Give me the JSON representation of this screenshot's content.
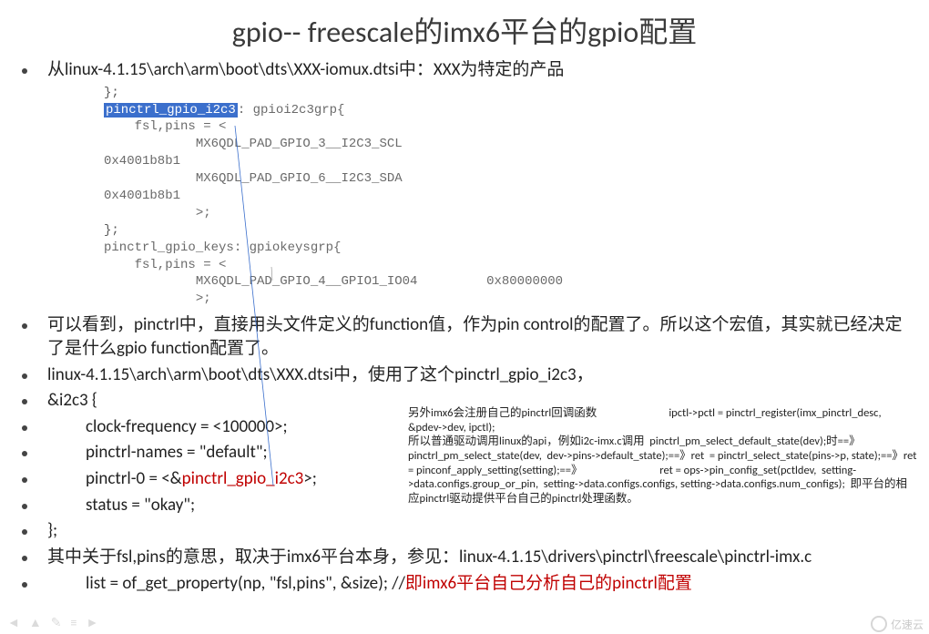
{
  "title": "gpio-- freescale的imx6平台的gpio配置",
  "bullets": {
    "b1": "从linux-4.1.15\\arch\\arm\\boot\\dts\\XXX-iomux.dtsi中：XXX为特定的产品",
    "b2": "可以看到，pinctrl中，直接用头文件定义的function值，作为pin control的配置了。所以这个宏值，其实就已经决定了是什么gpio function配置了。",
    "b3": "linux-4.1.15\\arch\\arm\\boot\\dts\\XXX.dtsi中，使用了这个pinctrl_gpio_i2c3，",
    "b4": "&i2c3 {",
    "b5": "clock-frequency = <100000>;",
    "b6": "pinctrl-names = \"default\";",
    "b7_prefix": "pinctrl-0 = <&",
    "b7_ref": "pinctrl_gpio_i2c3",
    "b7_suffix": ">;",
    "b8": "status = \"okay\";",
    "b9": "};",
    "b10": "其中关于fsl,pins的意思，取决于imx6平台本身，参见：linux-4.1.15\\drivers\\pinctrl\\freescale\\pinctrl-imx.c",
    "b11_prefix": "list = of_get_property(np, \"fsl,pins\", &size); //",
    "b11_comment": "即imx6平台自己分析自己的pinctrl配置"
  },
  "code": {
    "hl": "pinctrl_gpio_i2c3",
    "l0": "};",
    "l1_tail": ": gpioi2c3grp{",
    "l2": "    fsl,pins = <",
    "l3": "            MX6QDL_PAD_GPIO_3__I2C3_SCL        ",
    "l4": "0x4001b8b1",
    "l5": "            MX6QDL_PAD_GPIO_6__I2C3_SDA        ",
    "l6": "0x4001b8b1",
    "l7": "            >;",
    "l8": "};",
    "l9": "pinctrl_gpio_keys: gpiokeysgrp{",
    "l10": "    fsl,pins = <",
    "l11": "            MX6QDL_PAD_GPIO_4__GPIO1_IO04         0x80000000",
    "l12": "            >;"
  },
  "sidenote": "另外imx6会注册自己的pinctrl回调函数                            ipctl->pctl = pinctrl_register(imx_pinctrl_desc,  &pdev->dev, ipctl);\n所以普通驱动调用linux的api，例如i2c-imx.c调用  pinctrl_pm_select_default_state(dev);时==》pinctrl_pm_select_state(dev,  dev->pins->default_state);==》ret  = pinctrl_select_state(pins->p, state);==》ret = pinconf_apply_setting(setting);==》                              ret = ops->pin_config_set(pctldev,  setting->data.configs.group_or_pin,  setting->data.configs.configs, setting->data.configs.num_configs);  即平台的相应pinctrl驱动提供平台自己的pinctrl处理函数。",
  "watermark": "亿速云"
}
